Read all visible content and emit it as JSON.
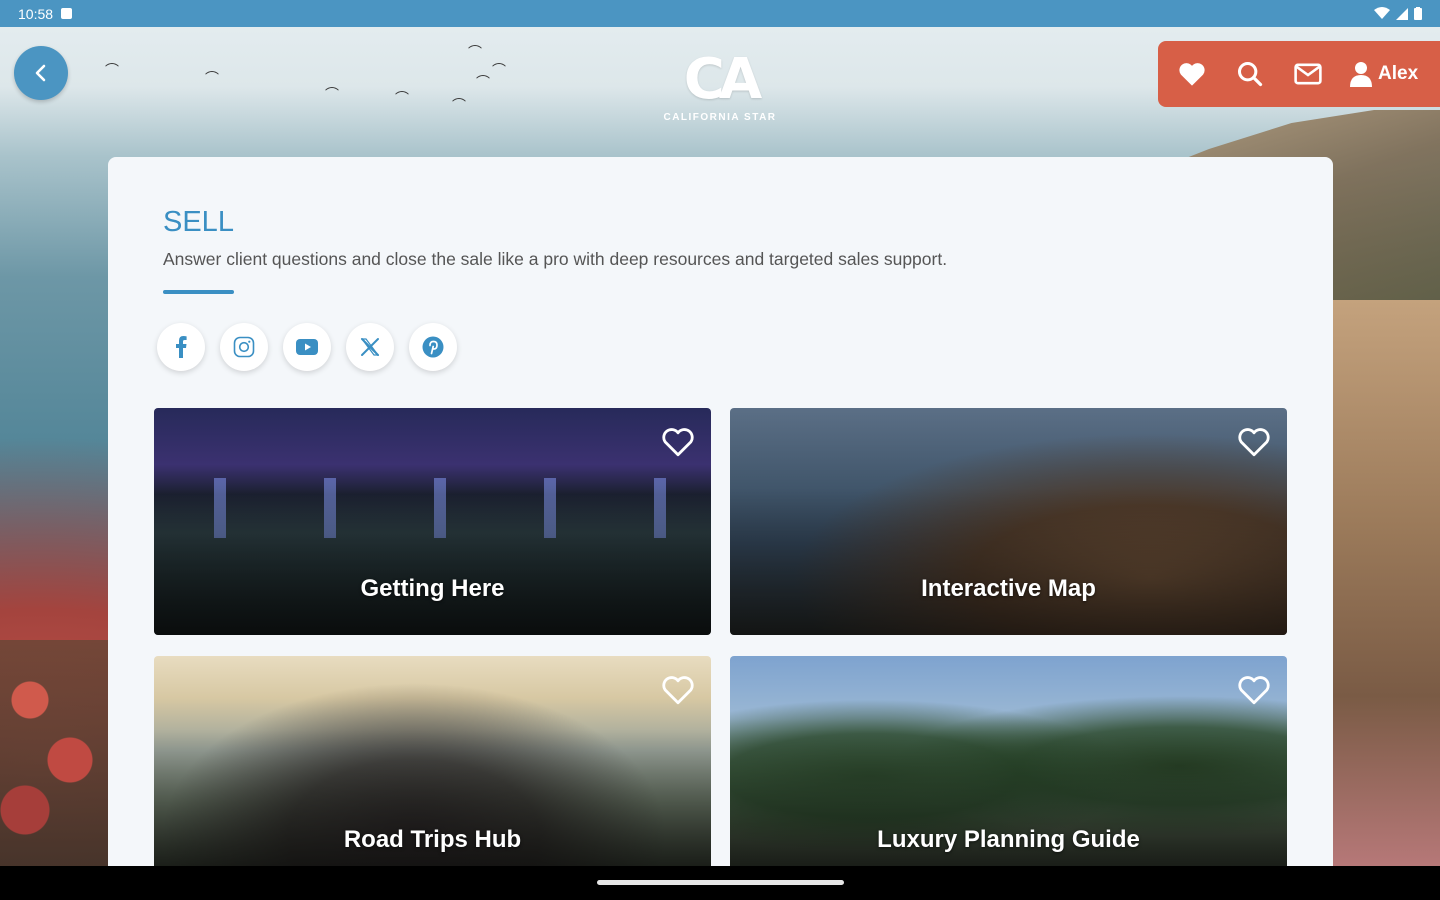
{
  "status_bar": {
    "time": "10:58"
  },
  "header": {
    "logo_mark": "CA",
    "logo_sub": "CALIFORNIA STAR",
    "account_name": "Alex"
  },
  "section": {
    "title": "SELL",
    "description": "Answer client questions and close the sale like a pro with deep resources and targeted sales support."
  },
  "socials": [
    {
      "name": "facebook-icon"
    },
    {
      "name": "instagram-icon"
    },
    {
      "name": "youtube-icon"
    },
    {
      "name": "x-icon"
    },
    {
      "name": "pinterest-icon"
    }
  ],
  "tiles": [
    {
      "label": "Getting Here"
    },
    {
      "label": "Interactive Map"
    },
    {
      "label": "Road Trips Hub"
    },
    {
      "label": "Luxury Planning Guide"
    }
  ],
  "colors": {
    "brand_blue": "#4b95c2",
    "accent_red": "#d75f47",
    "title_blue": "#3a8fc3"
  }
}
